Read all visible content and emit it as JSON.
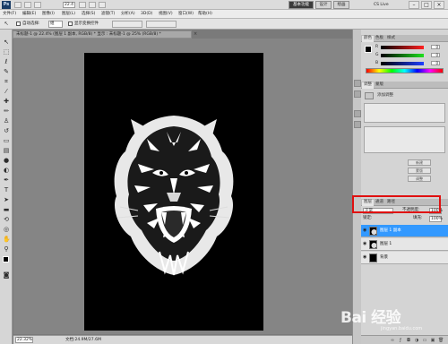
{
  "app": {
    "logo": "Ps",
    "zoom_value": "22.4",
    "workspace_buttons": [
      "基本功能",
      "设计",
      "绘画"
    ],
    "cslive": "CS Live"
  },
  "menus": [
    "文件(F)",
    "编辑(E)",
    "图像(I)",
    "图层(L)",
    "选择(S)",
    "滤镜(T)",
    "分析(A)",
    "3D(D)",
    "视图(V)",
    "窗口(W)",
    "帮助(H)"
  ],
  "options_bar": {
    "auto_select_label": "自动选择:",
    "auto_select_value": "组",
    "show_transform_label": "显示变换控件"
  },
  "document": {
    "tab_title": "未标题-1 @ 22.4% (图层 1 副本, RGB/8) * 显示 : 未标题-1 @ 25% (RGB/8) *",
    "zoom_status": "22.32%",
    "doc_status": "文档:24.9M/27.6M"
  },
  "panels": {
    "color_tabs": [
      "颜色",
      "色板",
      "样式"
    ],
    "color_values": {
      "R": "0",
      "G": "0",
      "B": "0"
    },
    "adjust_tabs": [
      "调整",
      "蒙版"
    ],
    "adjust_title": "添加调整",
    "adjust_buttons": [
      "新建",
      "蒙版",
      "调整"
    ],
    "layers_tabs": [
      "图层",
      "通道",
      "路径"
    ],
    "blend_mode": "正常",
    "opacity_label": "不透明度:",
    "opacity_value": "100%",
    "lock_label": "锁定:",
    "fill_label": "填充:",
    "fill_value": "100%",
    "layers": [
      {
        "name": "图层 1 副本",
        "selected": true
      },
      {
        "name": "图层 1",
        "selected": false
      },
      {
        "name": "背景",
        "selected": false
      }
    ]
  },
  "watermark": {
    "text": "Bai 经验",
    "sub": "jingyan.baidu.com"
  },
  "colors": {
    "selected_layer": "#3399ff",
    "highlight": "#e01010",
    "canvas": "#000000"
  }
}
